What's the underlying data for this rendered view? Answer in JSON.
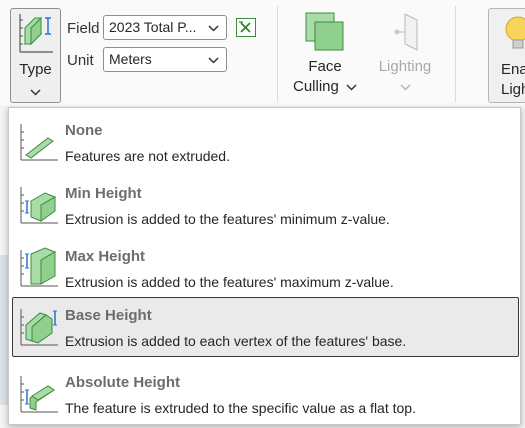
{
  "ribbon": {
    "type_button": {
      "label": "Type",
      "icon": "extrusion-type-icon"
    },
    "field": {
      "label": "Field",
      "value": "2023  Total  P...",
      "expression_icon": "expression-builder-icon"
    },
    "unit": {
      "label": "Unit",
      "value": "Meters"
    },
    "face_culling": {
      "line1": "Face",
      "line2": "Culling",
      "icon": "face-culling-icon"
    },
    "lighting": {
      "line1": "Lighting",
      "icon": "lighting-icon",
      "disabled": true
    },
    "enable_lighting": {
      "line1": "Ena",
      "line2": "Ligh",
      "icon": "lightbulb-icon"
    }
  },
  "background": {
    "right_frag1": "r",
    "right_frag2": "t"
  },
  "dropdown": {
    "options": [
      {
        "title": "None",
        "description": "Features are not extruded.",
        "icon": "extrusion-none-icon",
        "selected": false
      },
      {
        "title": "Min Height",
        "description": "Extrusion is added to the features' minimum z-value.",
        "icon": "extrusion-min-height-icon",
        "selected": false
      },
      {
        "title": "Max Height",
        "description": "Extrusion is added to the features' maximum z-value.",
        "icon": "extrusion-max-height-icon",
        "selected": false
      },
      {
        "title": "Base Height",
        "description": "Extrusion is added to each vertex of the features' base.",
        "icon": "extrusion-base-height-icon",
        "selected": true
      },
      {
        "title": "Absolute Height",
        "description": "The feature is extruded to the specific value as a flat top.",
        "icon": "extrusion-absolute-height-icon",
        "selected": false
      }
    ]
  },
  "colors": {
    "icon_green": "#8fd08f",
    "icon_green_dark": "#3d8c3d",
    "axis_blue": "#2b6fd6",
    "selected_border": "#3a3a3a"
  }
}
